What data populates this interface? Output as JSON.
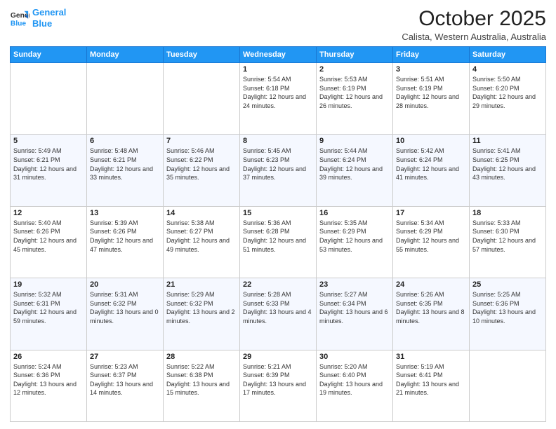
{
  "header": {
    "logo_line1": "General",
    "logo_line2": "Blue",
    "month": "October 2025",
    "location": "Calista, Western Australia, Australia"
  },
  "weekdays": [
    "Sunday",
    "Monday",
    "Tuesday",
    "Wednesday",
    "Thursday",
    "Friday",
    "Saturday"
  ],
  "weeks": [
    [
      null,
      null,
      null,
      {
        "day": 1,
        "sunrise": "5:54 AM",
        "sunset": "6:18 PM",
        "daylight": "12 hours and 24 minutes."
      },
      {
        "day": 2,
        "sunrise": "5:53 AM",
        "sunset": "6:19 PM",
        "daylight": "12 hours and 26 minutes."
      },
      {
        "day": 3,
        "sunrise": "5:51 AM",
        "sunset": "6:19 PM",
        "daylight": "12 hours and 28 minutes."
      },
      {
        "day": 4,
        "sunrise": "5:50 AM",
        "sunset": "6:20 PM",
        "daylight": "12 hours and 29 minutes."
      }
    ],
    [
      {
        "day": 5,
        "sunrise": "5:49 AM",
        "sunset": "6:21 PM",
        "daylight": "12 hours and 31 minutes."
      },
      {
        "day": 6,
        "sunrise": "5:48 AM",
        "sunset": "6:21 PM",
        "daylight": "12 hours and 33 minutes."
      },
      {
        "day": 7,
        "sunrise": "5:46 AM",
        "sunset": "6:22 PM",
        "daylight": "12 hours and 35 minutes."
      },
      {
        "day": 8,
        "sunrise": "5:45 AM",
        "sunset": "6:23 PM",
        "daylight": "12 hours and 37 minutes."
      },
      {
        "day": 9,
        "sunrise": "5:44 AM",
        "sunset": "6:24 PM",
        "daylight": "12 hours and 39 minutes."
      },
      {
        "day": 10,
        "sunrise": "5:42 AM",
        "sunset": "6:24 PM",
        "daylight": "12 hours and 41 minutes."
      },
      {
        "day": 11,
        "sunrise": "5:41 AM",
        "sunset": "6:25 PM",
        "daylight": "12 hours and 43 minutes."
      }
    ],
    [
      {
        "day": 12,
        "sunrise": "5:40 AM",
        "sunset": "6:26 PM",
        "daylight": "12 hours and 45 minutes."
      },
      {
        "day": 13,
        "sunrise": "5:39 AM",
        "sunset": "6:26 PM",
        "daylight": "12 hours and 47 minutes."
      },
      {
        "day": 14,
        "sunrise": "5:38 AM",
        "sunset": "6:27 PM",
        "daylight": "12 hours and 49 minutes."
      },
      {
        "day": 15,
        "sunrise": "5:36 AM",
        "sunset": "6:28 PM",
        "daylight": "12 hours and 51 minutes."
      },
      {
        "day": 16,
        "sunrise": "5:35 AM",
        "sunset": "6:29 PM",
        "daylight": "12 hours and 53 minutes."
      },
      {
        "day": 17,
        "sunrise": "5:34 AM",
        "sunset": "6:29 PM",
        "daylight": "12 hours and 55 minutes."
      },
      {
        "day": 18,
        "sunrise": "5:33 AM",
        "sunset": "6:30 PM",
        "daylight": "12 hours and 57 minutes."
      }
    ],
    [
      {
        "day": 19,
        "sunrise": "5:32 AM",
        "sunset": "6:31 PM",
        "daylight": "12 hours and 59 minutes."
      },
      {
        "day": 20,
        "sunrise": "5:31 AM",
        "sunset": "6:32 PM",
        "daylight": "13 hours and 0 minutes."
      },
      {
        "day": 21,
        "sunrise": "5:29 AM",
        "sunset": "6:32 PM",
        "daylight": "13 hours and 2 minutes."
      },
      {
        "day": 22,
        "sunrise": "5:28 AM",
        "sunset": "6:33 PM",
        "daylight": "13 hours and 4 minutes."
      },
      {
        "day": 23,
        "sunrise": "5:27 AM",
        "sunset": "6:34 PM",
        "daylight": "13 hours and 6 minutes."
      },
      {
        "day": 24,
        "sunrise": "5:26 AM",
        "sunset": "6:35 PM",
        "daylight": "13 hours and 8 minutes."
      },
      {
        "day": 25,
        "sunrise": "5:25 AM",
        "sunset": "6:36 PM",
        "daylight": "13 hours and 10 minutes."
      }
    ],
    [
      {
        "day": 26,
        "sunrise": "5:24 AM",
        "sunset": "6:36 PM",
        "daylight": "13 hours and 12 minutes."
      },
      {
        "day": 27,
        "sunrise": "5:23 AM",
        "sunset": "6:37 PM",
        "daylight": "13 hours and 14 minutes."
      },
      {
        "day": 28,
        "sunrise": "5:22 AM",
        "sunset": "6:38 PM",
        "daylight": "13 hours and 15 minutes."
      },
      {
        "day": 29,
        "sunrise": "5:21 AM",
        "sunset": "6:39 PM",
        "daylight": "13 hours and 17 minutes."
      },
      {
        "day": 30,
        "sunrise": "5:20 AM",
        "sunset": "6:40 PM",
        "daylight": "13 hours and 19 minutes."
      },
      {
        "day": 31,
        "sunrise": "5:19 AM",
        "sunset": "6:41 PM",
        "daylight": "13 hours and 21 minutes."
      },
      null
    ]
  ]
}
